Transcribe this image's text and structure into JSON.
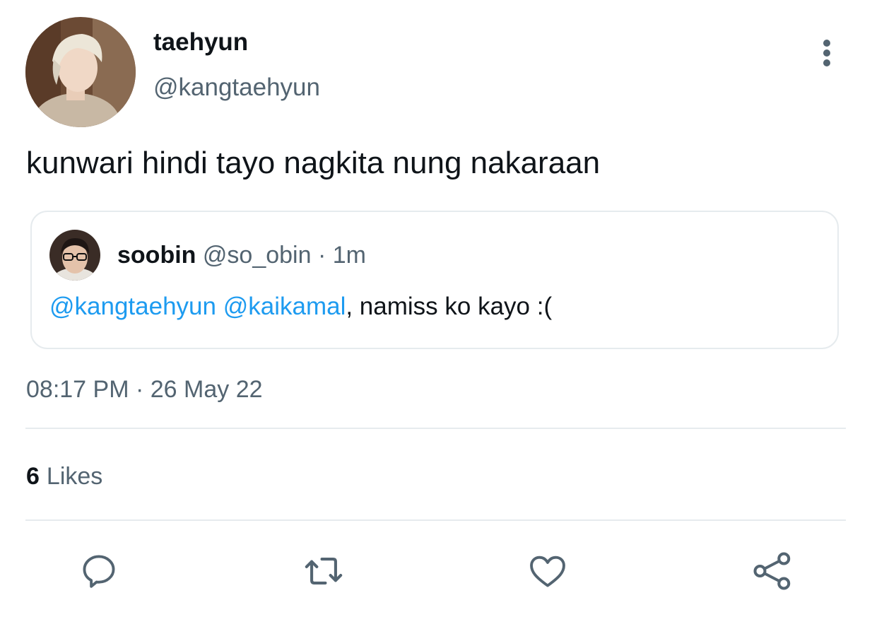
{
  "tweet": {
    "author": {
      "display_name": "taehyun",
      "handle": "@kangtaehyun",
      "avatar_icon": "profile-photo"
    },
    "text": "kunwari hindi tayo nagkita nung nakaraan",
    "quoted": {
      "display_name": "soobin",
      "handle": "@so_obin",
      "separator": "·",
      "time": "1m",
      "mention_1": "@kangtaehyun",
      "mention_2": "@kaikamal",
      "text_rest": ", namiss ko kayo :("
    },
    "time": "08:17 PM",
    "date_separator": "·",
    "date": "26 May 22",
    "likes_count": "6",
    "likes_label": "Likes"
  },
  "actions": [
    "reply-icon",
    "retweet-icon",
    "like-icon",
    "share-icon"
  ],
  "colors": {
    "text": "#0f1419",
    "secondary": "#536471",
    "link": "#1d9bf0",
    "border": "#e6ebee"
  }
}
